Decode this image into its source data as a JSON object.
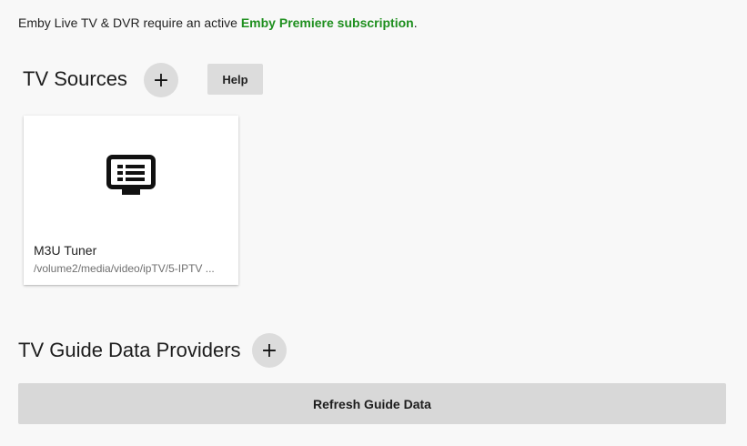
{
  "notice": {
    "text": "Emby Live TV & DVR require an active ",
    "link_label": "Emby Premiere subscription",
    "suffix": ".",
    "link_color": "#1e8f1e"
  },
  "tv_sources": {
    "title": "TV Sources",
    "add_label": "+",
    "help_label": "Help",
    "cards": [
      {
        "title": "M3U Tuner",
        "subtitle": "/volume2/media/video/ipTV/5-IPTV ...",
        "icon": "tv-guide-icon"
      }
    ]
  },
  "guide_providers": {
    "title": "TV Guide Data Providers",
    "add_label": "+",
    "refresh_label": "Refresh Guide Data"
  }
}
